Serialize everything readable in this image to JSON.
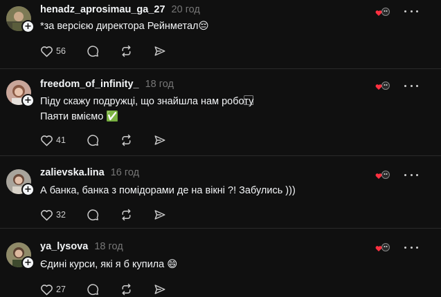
{
  "posts": [
    {
      "username": "henadz_aprosimau_ga_27",
      "time": "20 год",
      "lines": [
        "*за версією директора Рейнметал"
      ],
      "line_emojis": [
        "😔"
      ],
      "likes": "56"
    },
    {
      "username": "freedom_of_infinity_",
      "time": "18 год",
      "lines": [
        "Піду скажу подружці, що знайшла нам роботу",
        "Паяти вміємо"
      ],
      "line_emojis": [
        "⃞",
        "✅"
      ],
      "likes": "41"
    },
    {
      "username": "zalievska.lina",
      "time": "16 год",
      "lines": [
        "А банка, банка з помідорами де на вікні ?! Забулись )))"
      ],
      "line_emojis": [
        ""
      ],
      "likes": "32"
    },
    {
      "username": "ya_lysova",
      "time": "18 год",
      "lines": [
        "Єдині курси, які я б купила"
      ],
      "line_emojis": [
        "😄"
      ],
      "likes": "27"
    }
  ],
  "icons": {
    "like": "heart-icon",
    "comment": "comment-bubble-icon",
    "repost": "repost-icon",
    "share": "send-icon",
    "more": "more-dots-icon",
    "reaction": "reaction-icon",
    "follow": "plus-icon"
  },
  "colors": {
    "background": "#101010",
    "text": "#f3f5f7",
    "muted": "#777777",
    "reaction_red": "#ff3040"
  }
}
